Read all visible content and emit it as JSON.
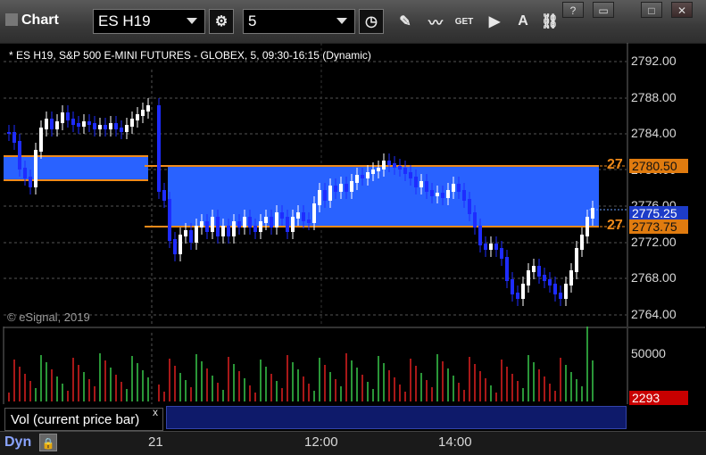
{
  "app": {
    "title": "Chart"
  },
  "toolbar": {
    "symbol": "ES H19",
    "interval": "5",
    "buttons": [
      "settings-icon",
      "clock-icon",
      "pencil-icon",
      "studies-icon",
      "get-icon",
      "play-icon",
      "alert-icon",
      "link-icon"
    ],
    "get_label": "GET",
    "alert_label": "A"
  },
  "window_buttons": {
    "help": "?",
    "restore": "▭",
    "maximize": "□",
    "close": "✕"
  },
  "chart": {
    "info": "* ES H19, S&P 500 E-MINI FUTURES - GLOBEX, 5, 09:30-16:15 (Dynamic)",
    "copyright": "© eSignal, 2019",
    "price_axis": [
      "2792.00",
      "2788.00",
      "2784.00",
      "2780.00",
      "2776.00",
      "2772.00",
      "2768.00",
      "2764.00"
    ],
    "level_upper": "2780.50",
    "level_lower": "2773.75",
    "level_marker_upper": "27",
    "level_marker_lower": "27",
    "last_price": "2775.25",
    "volume_axis": "50000",
    "volume_current": "2293",
    "time_axis": [
      "21",
      "12:00",
      "14:00"
    ],
    "colors": {
      "up": "#ffffff",
      "down": "#1e2cff",
      "zone": "#2962ff",
      "level": "#f08a1a",
      "vol_up": "#39c84a",
      "vol_down": "#e02020"
    }
  },
  "volume_panel": {
    "label": "Vol (current price bar)",
    "close": "x"
  },
  "bottom": {
    "dyn": "Dyn",
    "lock": "🔒"
  }
}
